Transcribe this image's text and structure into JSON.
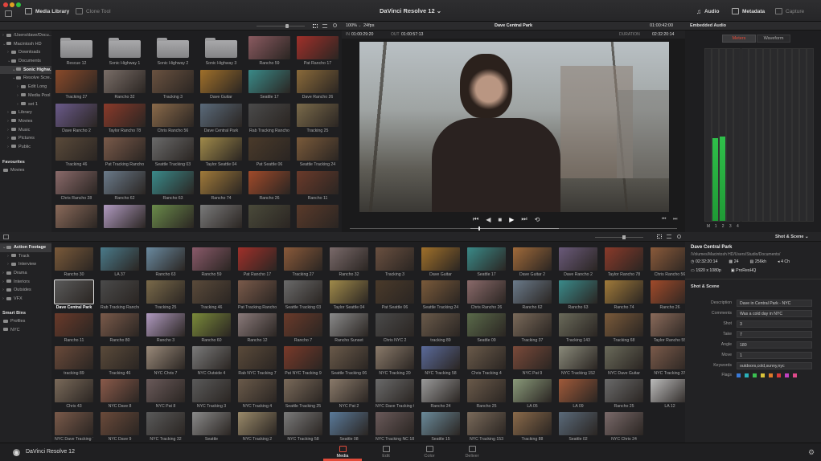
{
  "titlebar": {
    "media_library": "Media Library",
    "clone_tool": "Clone Tool",
    "app_title": "DaVinci Resolve 12",
    "audio": "Audio",
    "metadata": "Metadata",
    "capture": "Capture"
  },
  "tree": {
    "items": [
      {
        "label": "/Users/dave/Docu...",
        "indent": 0,
        "arrow": "›"
      },
      {
        "label": "Macintosh HD",
        "indent": 0,
        "arrow": "⌄"
      },
      {
        "label": "Downloads",
        "indent": 1,
        "arrow": "›"
      },
      {
        "label": "Documents",
        "indent": 1,
        "arrow": "⌄"
      },
      {
        "label": "Sonic Highw...",
        "indent": 2,
        "arrow": "⌄",
        "selected": true
      },
      {
        "label": "Resolve Scre...",
        "indent": 2,
        "arrow": "⌄"
      },
      {
        "label": "Edit Long",
        "indent": 3,
        "arrow": "›"
      },
      {
        "label": "Media Pool",
        "indent": 3,
        "arrow": "›"
      },
      {
        "label": "set 1",
        "indent": 3,
        "arrow": "›"
      },
      {
        "label": "Library",
        "indent": 1,
        "arrow": "›"
      },
      {
        "label": "Movies",
        "indent": 1,
        "arrow": "›"
      },
      {
        "label": "Music",
        "indent": 1,
        "arrow": "›"
      },
      {
        "label": "Pictures",
        "indent": 1,
        "arrow": "›"
      },
      {
        "label": "Public",
        "indent": 1,
        "arrow": "›"
      }
    ],
    "favourites_label": "Favourites",
    "favourites": [
      "Movies"
    ]
  },
  "media_library": {
    "thumbs": [
      {
        "label": "Rescue 12",
        "folder": true
      },
      {
        "label": "Sonic Highway 1",
        "folder": true
      },
      {
        "label": "Sonic Highway 2",
        "folder": true
      },
      {
        "label": "Sonic Highway 3",
        "folder": true
      },
      {
        "label": "Rancho 59",
        "color": "#8a5a60"
      },
      {
        "label": "Pat Rancho 17",
        "color": "#a0302a"
      },
      {
        "label": "Tracking 27",
        "color": "#8a4a2a"
      },
      {
        "label": "Rancho 32",
        "color": "#7a6e68"
      },
      {
        "label": "Tracking 3",
        "color": "#6a5240"
      },
      {
        "label": "Dave Guitar",
        "color": "#a0702a"
      },
      {
        "label": "Seattle 17",
        "color": "#3a8a88"
      },
      {
        "label": "Dave Rancho 26",
        "color": "#8a6a3a"
      },
      {
        "label": "Dave Rancho 2",
        "color": "#6a5a8a"
      },
      {
        "label": "Taylor Rancho 78",
        "color": "#8a3a2a"
      },
      {
        "label": "Chris Rancho 56",
        "color": "#8a6a4a"
      },
      {
        "label": "Dave Central Park",
        "color": "#5a6a7a"
      },
      {
        "label": "Rab Tracking Rancho",
        "color": "#4a4a4a"
      },
      {
        "label": "Tracking 25",
        "color": "#7a6a4a"
      },
      {
        "label": "Tracking 46",
        "color": "#5a4a3a"
      },
      {
        "label": "Pat Tracking Rancho",
        "color": "#7a5a4a"
      },
      {
        "label": "Seattle Tracking 03",
        "color": "#6a6a6a"
      },
      {
        "label": "Taylor Seattle 04",
        "color": "#a08a4a"
      },
      {
        "label": "Pat Seattle 06",
        "color": "#4a3a2a"
      },
      {
        "label": "Seattle Tracking 24",
        "color": "#7a5a3a"
      },
      {
        "label": "Chris Rancho 28",
        "color": "#8a6a6a"
      },
      {
        "label": "Rancho 62",
        "color": "#6a7a8a"
      },
      {
        "label": "Rancho 63",
        "color": "#3a8a8a"
      },
      {
        "label": "Rancho 74",
        "color": "#a07a3a"
      },
      {
        "label": "Rancho 26",
        "color": "#a04a2a"
      },
      {
        "label": "Rancho 11",
        "color": "#6a3a2a"
      },
      {
        "label": "",
        "color": "#8a6a5a"
      },
      {
        "label": "",
        "color": "#b09ac0"
      },
      {
        "label": "",
        "color": "#6a8a4a"
      },
      {
        "label": "",
        "color": "#7a7a7a"
      },
      {
        "label": "",
        "color": "#4a4a3a"
      },
      {
        "label": "",
        "color": "#5a3a2a"
      }
    ]
  },
  "viewer": {
    "zoom": "100%",
    "fps": "24fps",
    "clip_name": "Dave Central Park",
    "duration_top": "01:00:42:00",
    "in_label": "IN",
    "in_tc": "01:00:29:20",
    "out_label": "OUT",
    "out_tc": "01:00:57:13",
    "duration_label": "DURATION",
    "duration_tc": "02:32:20:14"
  },
  "audio": {
    "title": "Embedded Audio",
    "tab_meters": "Meters",
    "tab_waveform": "Waveform",
    "levels": [
      0,
      0.48,
      0.49,
      0,
      0,
      0,
      0,
      0,
      0,
      0,
      0,
      0,
      0,
      0,
      0
    ],
    "channel_labels": [
      "M",
      "1",
      "2",
      "3",
      "4",
      "",
      "",
      "",
      "",
      "",
      "",
      "",
      "",
      "",
      ""
    ]
  },
  "media_pool": {
    "bins": {
      "items": [
        {
          "label": "Action Footage",
          "indent": 0,
          "arrow": "⌄",
          "selected": true
        },
        {
          "label": "Track",
          "indent": 1,
          "arrow": "›"
        },
        {
          "label": "Interview",
          "indent": 1,
          "arrow": "›"
        },
        {
          "label": "Drama",
          "indent": 0,
          "arrow": "›"
        },
        {
          "label": "Interiors",
          "indent": 0,
          "arrow": "›"
        },
        {
          "label": "Outsides",
          "indent": 0,
          "arrow": "›"
        },
        {
          "label": "VFX",
          "indent": 0,
          "arrow": "›"
        }
      ],
      "smart_bins_label": "Smart Bins",
      "smart_bins": [
        "Profiles",
        "NYC"
      ]
    },
    "thumbs": [
      {
        "label": "Rancho 30",
        "color": "#7a5a3a"
      },
      {
        "label": "LA 37",
        "color": "#4a7a8a"
      },
      {
        "label": "Rancho 63",
        "color": "#6a8aa0"
      },
      {
        "label": "Rancho 59",
        "color": "#8a5a6a"
      },
      {
        "label": "Pat Rancho 17",
        "color": "#a0302a"
      },
      {
        "label": "Tracking 27",
        "color": "#8a5a3a"
      },
      {
        "label": "Rancho 32",
        "color": "#7a6a6a"
      },
      {
        "label": "Tracking 3",
        "color": "#6a5040"
      },
      {
        "label": "Dave Guitar",
        "color": "#a0702a"
      },
      {
        "label": "Seattle 17",
        "color": "#3a8a88"
      },
      {
        "label": "Dave Guitar 2",
        "color": "#a06a3a"
      },
      {
        "label": "Dave Rancho 2",
        "color": "#6a5a7a"
      },
      {
        "label": "Taylor Rancho 78",
        "color": "#8a3a2a"
      },
      {
        "label": "Chris Rancho 56",
        "color": "#8a5a3a"
      },
      {
        "label": "Dave Central Park",
        "color": "#5a5a5a",
        "selected": true
      },
      {
        "label": "Rab Tracking Rancho",
        "color": "#4a4a4a"
      },
      {
        "label": "Tracking 25",
        "color": "#7a6a4a"
      },
      {
        "label": "Tracking 46",
        "color": "#5a4a3a"
      },
      {
        "label": "Pat Tracking Rancho",
        "color": "#7a5a4a"
      },
      {
        "label": "Seattle Tracking 03",
        "color": "#6a6a6a"
      },
      {
        "label": "Taylor Seattle 04",
        "color": "#a08a4a"
      },
      {
        "label": "Pat Seattle 06",
        "color": "#4a3a2a"
      },
      {
        "label": "Seattle Tracking 24",
        "color": "#7a5a3a"
      },
      {
        "label": "Chris Rancho 26",
        "color": "#8a6a6a"
      },
      {
        "label": "Rancho 62",
        "color": "#6a7a8a"
      },
      {
        "label": "Rancho 63",
        "color": "#3a8a8a"
      },
      {
        "label": "Rancho 74",
        "color": "#a07a3a"
      },
      {
        "label": "Rancho 26",
        "color": "#a04a2a"
      },
      {
        "label": "Rancho 11",
        "color": "#6a3a2a"
      },
      {
        "label": "Rancho 80",
        "color": "#7a5a4a"
      },
      {
        "label": "Rancho 3",
        "color": "#b09ac0"
      },
      {
        "label": "Rancho 60",
        "color": "#7a8a3a"
      },
      {
        "label": "Rancho 12",
        "color": "#8a7a7a"
      },
      {
        "label": "Rancho 7",
        "color": "#6a3a2a"
      },
      {
        "label": "Rancho Sunset",
        "color": "#8a8a8a"
      },
      {
        "label": "Chris NYC 2",
        "color": "#4a4a4a"
      },
      {
        "label": "tracking 89",
        "color": "#6a5a4a"
      },
      {
        "label": "Seattle 09",
        "color": "#5a6a4a"
      },
      {
        "label": "Tracking 37",
        "color": "#7a6a5a"
      },
      {
        "label": "Tracking 143",
        "color": "#6a6a5a"
      },
      {
        "label": "Tracking 68",
        "color": "#7a5a3a"
      },
      {
        "label": "Taylor Rancho 55",
        "color": "#8a6a5a"
      },
      {
        "label": "tracking 89",
        "color": "#6a4a3a"
      },
      {
        "label": "Tracking 46",
        "color": "#5a4a3a"
      },
      {
        "label": "NYC Chris 7",
        "color": "#9a8a7a"
      },
      {
        "label": "NYC Outside 4",
        "color": "#7a7a7a"
      },
      {
        "label": "Rab NYC Tracking 7",
        "color": "#5a4a3a"
      },
      {
        "label": "Pat NYC Tracking 9",
        "color": "#7a3a2a"
      },
      {
        "label": "Seattle Tracking 06",
        "color": "#6a5a4a"
      },
      {
        "label": "NYC Tracking 20",
        "color": "#8a7a6a"
      },
      {
        "label": "NYC Tracking 58",
        "color": "#5a6a9a"
      },
      {
        "label": "Chris Tracking 4",
        "color": "#6a5a4a"
      },
      {
        "label": "NYC Pat 9",
        "color": "#7a4a3a"
      },
      {
        "label": "NYC Tracking 152",
        "color": "#8a8a7a"
      },
      {
        "label": "NYC Dave Guitar",
        "color": "#6a6a5a"
      },
      {
        "label": "NYC Tracking 37",
        "color": "#7a5a4a"
      },
      {
        "label": "Chris 43",
        "color": "#7a6a5a"
      },
      {
        "label": "NYC Dave 8",
        "color": "#8a5a4a"
      },
      {
        "label": "NYC Pat 8",
        "color": "#6a5a5a"
      },
      {
        "label": "NYC Tracking 3",
        "color": "#5a5a5a"
      },
      {
        "label": "NYC Tracking 4",
        "color": "#6a5a4a"
      },
      {
        "label": "Seattle Tracking 25",
        "color": "#7a6a5a"
      },
      {
        "label": "NYC Pat 2",
        "color": "#8a7a6a"
      },
      {
        "label": "NYC Dave Tracking 6",
        "color": "#6a6a6a"
      },
      {
        "label": "Rancho 24",
        "color": "#9a9a9a"
      },
      {
        "label": "Rancho 25",
        "color": "#6a5a4a"
      },
      {
        "label": "LA 05",
        "color": "#8a9a7a"
      },
      {
        "label": "LA 09",
        "color": "#a05a3a"
      },
      {
        "label": "Rancho 25",
        "color": "#6a6a6a"
      },
      {
        "label": "LA 12",
        "color": "#bbbbbb"
      },
      {
        "label": "NYC Dave Tracking 78",
        "color": "#7a5a4a"
      },
      {
        "label": "NYC Dave 9",
        "color": "#6a4a3a"
      },
      {
        "label": "NYC Tracking 32",
        "color": "#5a5a5a"
      },
      {
        "label": "Seattle",
        "color": "#8a8a8a"
      },
      {
        "label": "NYC Tracking 2",
        "color": "#9a8a6a"
      },
      {
        "label": "NYC Tracking 58",
        "color": "#7a7a7a"
      },
      {
        "label": "Seattle 08",
        "color": "#5a7a9a"
      },
      {
        "label": "NYC Tracking NC 18",
        "color": "#6a5a5a"
      },
      {
        "label": "Seattle 15",
        "color": "#6a8a9a"
      },
      {
        "label": "NYC Tracking 153",
        "color": "#7a6a5a"
      },
      {
        "label": "Tracking 88",
        "color": "#8a6a4a"
      },
      {
        "label": "Seattle 02",
        "color": "#5a6a7a"
      },
      {
        "label": "NYC Chris 24",
        "color": "#7a6a6a"
      }
    ]
  },
  "metadata": {
    "dropdown": "Shot & Scene",
    "clip_name": "Dave Central Park",
    "path": "/Volumes/Macintosh HD/Users/Studio/Documents/",
    "duration": "02:32:20:14",
    "fps": "24",
    "audio_rate": "256kh",
    "channels": "4 Ch",
    "resolution": "1920 x 1080p",
    "codec": "ProResHQ",
    "section_title": "Shot & Scene",
    "fields": [
      {
        "key": "Description",
        "value": "Dave in Central Park - NYC"
      },
      {
        "key": "Comments",
        "value": "Was a cold day in NYC"
      },
      {
        "key": "Shot",
        "value": "3"
      },
      {
        "key": "Take",
        "value": "7"
      },
      {
        "key": "Angle",
        "value": "180"
      },
      {
        "key": "Move",
        "value": "1"
      },
      {
        "key": "Keywords",
        "value": "outdoors,cold,sunny,nyc"
      }
    ],
    "flags_label": "Flags",
    "flag_colors": [
      "#3a7ad8",
      "#2ab0b8",
      "#3ac050",
      "#d8c23a",
      "#e07a2a",
      "#d83a3a",
      "#c040c0",
      "#e04a8a"
    ]
  },
  "bottombar": {
    "app_name": "DaVinci Resolve 12",
    "pages": [
      {
        "label": "Media",
        "active": true
      },
      {
        "label": "Edit"
      },
      {
        "label": "Color"
      },
      {
        "label": "Deliver"
      }
    ]
  }
}
